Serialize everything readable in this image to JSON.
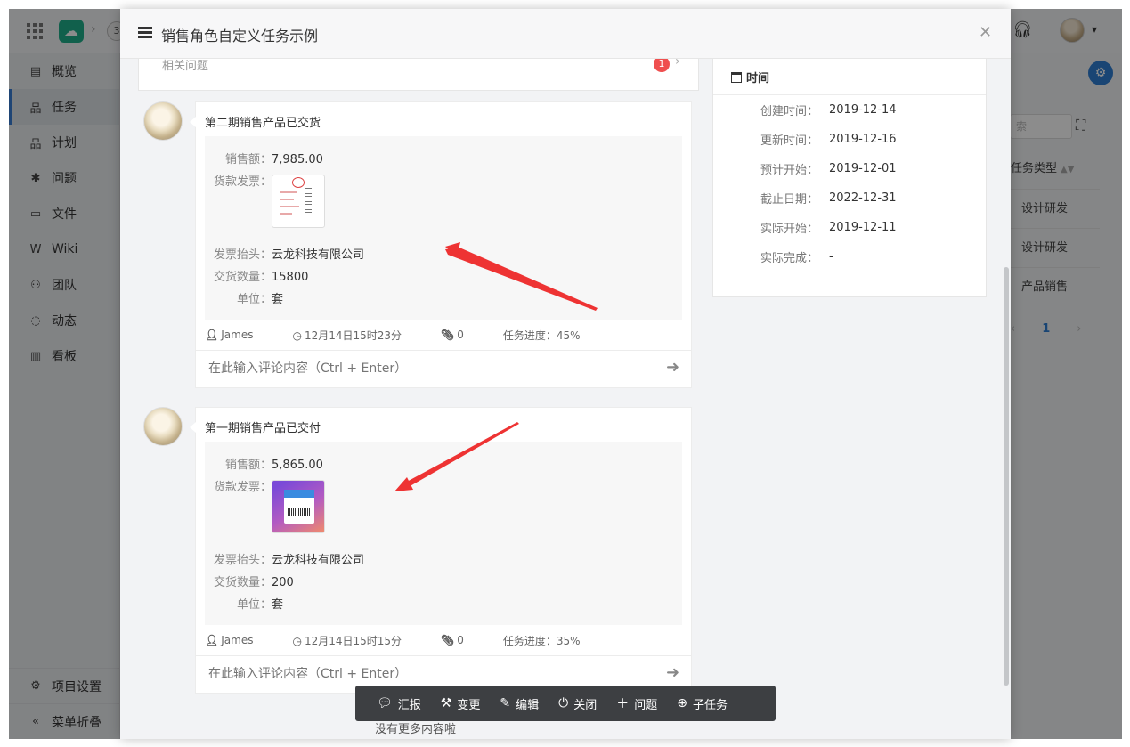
{
  "background": {
    "project_badge": "3",
    "sidebar": {
      "items": [
        {
          "icon": "overview-icon",
          "glyph": "▤",
          "label": "概览"
        },
        {
          "icon": "task-icon",
          "glyph": "品",
          "label": "任务"
        },
        {
          "icon": "plan-icon",
          "glyph": "品",
          "label": "计划"
        },
        {
          "icon": "bug-icon",
          "glyph": "✱",
          "label": "问题"
        },
        {
          "icon": "folder-icon",
          "glyph": "▭",
          "label": "文件"
        },
        {
          "icon": "wiki-icon",
          "glyph": "W",
          "label": "Wiki"
        },
        {
          "icon": "team-icon",
          "glyph": "⚇",
          "label": "团队"
        },
        {
          "icon": "activity-icon",
          "glyph": "◌",
          "label": "动态"
        },
        {
          "icon": "board-icon",
          "glyph": "▥",
          "label": "看板"
        }
      ],
      "settings_label": "项目设置",
      "collapse_label": "菜单折叠"
    },
    "right_panel": {
      "search_placeholder": "索",
      "column_header": "任务类型",
      "rows": [
        "设计研发",
        "设计研发",
        "产品销售"
      ],
      "page": "1"
    }
  },
  "modal": {
    "title": "销售角色自定义任务示例",
    "related": {
      "label": "相关问题",
      "count": "1"
    },
    "time": {
      "heading": "时间",
      "rows": [
        {
          "key": "创建时间：",
          "value": "2019-12-14"
        },
        {
          "key": "更新时间：",
          "value": "2019-12-16"
        },
        {
          "key": "预计开始：",
          "value": "2019-12-01"
        },
        {
          "key": "截止日期：",
          "value": "2022-12-31"
        },
        {
          "key": "实际开始：",
          "value": "2019-12-11"
        },
        {
          "key": "实际完成：",
          "value": "-"
        }
      ]
    },
    "entries": [
      {
        "title": "第二期销售产品已交货",
        "sales_key": "销售额：",
        "sales": "7,985.00",
        "invoice_key": "货款发票：",
        "header_key": "发票抬头：",
        "header": "云龙科技有限公司",
        "qty_key": "交货数量：",
        "qty": "15800",
        "unit_key": "单位：",
        "unit": "套",
        "author": "James",
        "time": "12月14日15时23分",
        "attachments": "0",
        "progress": "任务进度：45%",
        "comment_placeholder": "在此输入评论内容（Ctrl + Enter）"
      },
      {
        "title": "第一期销售产品已交付",
        "sales_key": "销售额：",
        "sales": "5,865.00",
        "invoice_key": "货款发票：",
        "header_key": "发票抬头：",
        "header": "云龙科技有限公司",
        "qty_key": "交货数量：",
        "qty": "200",
        "unit_key": "单位：",
        "unit": "套",
        "author": "James",
        "time": "12月14日15时15分",
        "attachments": "0",
        "progress": "任务进度：35%",
        "comment_placeholder": "在此输入评论内容（Ctrl + Enter）"
      }
    ],
    "toolbar": {
      "report": "汇报",
      "change": "变更",
      "edit": "编辑",
      "close": "关闭",
      "issue": "问题",
      "subtask": "子任务"
    },
    "no_more": "没有更多内容啦"
  },
  "colors": {
    "accent": "#2f7fd3",
    "badge": "#ef4f4f",
    "arrow": "#ee3333",
    "toolbar_bg": "#3d3f42"
  }
}
